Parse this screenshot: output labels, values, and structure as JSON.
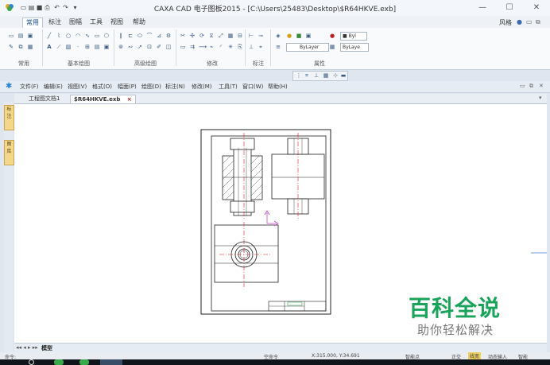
{
  "window": {
    "title": "CAXA CAD 电子图板2015 - [C:\\Users\\25483\\Desktop\\$R64HKVE.exb]",
    "minimize": "—",
    "maximize": "☐",
    "close": "✕"
  },
  "quick_access": [
    "new-icon",
    "open-icon",
    "save-icon",
    "print-icon",
    "undo-icon",
    "redo-icon"
  ],
  "ribbon_tabs": [
    {
      "label": "常用",
      "active": true
    },
    {
      "label": "标注",
      "active": false
    },
    {
      "label": "图幅",
      "active": false
    },
    {
      "label": "工具",
      "active": false
    },
    {
      "label": "视图",
      "active": false
    },
    {
      "label": "帮助",
      "active": false
    }
  ],
  "style_menu": "风格",
  "ribbon_groups": {
    "common": "常用",
    "basic_draw": "基本绘图",
    "advanced_draw": "高级绘图",
    "modify": "修改",
    "annotate": "标注",
    "properties": "属性"
  },
  "properties": {
    "layer": "Byl",
    "linetype": "ByLayer",
    "color": "ByLaye"
  },
  "menu_bar": [
    "文件(F)",
    "编辑(E)",
    "视图(V)",
    "格式(O)",
    "幅面(P)",
    "绘图(D)",
    "标注(N)",
    "修改(M)",
    "工具(T)",
    "窗口(W)",
    "帮助(H)"
  ],
  "doc_tabs": [
    {
      "label": "工程图文档1",
      "active": false
    },
    {
      "label": "$R64HKVE.exb",
      "active": true
    }
  ],
  "left_dock": [
    "标注",
    "图库"
  ],
  "layout_tab": "模型",
  "status": {
    "command": "命令:",
    "idle": "空命令",
    "coords": "X:315.000, Y:34.691",
    "snap_label": "智能点",
    "ortho": "正交",
    "linewidth": "线宽",
    "dynamic": "动态输入",
    "smart": "智能"
  },
  "watermark": {
    "main": "百科全说",
    "sub": "助你轻松解决"
  },
  "colors": {
    "ribbon_accent": "#1d4f91",
    "center_line": "#e02020",
    "watermark_green": "#1aa35a"
  }
}
